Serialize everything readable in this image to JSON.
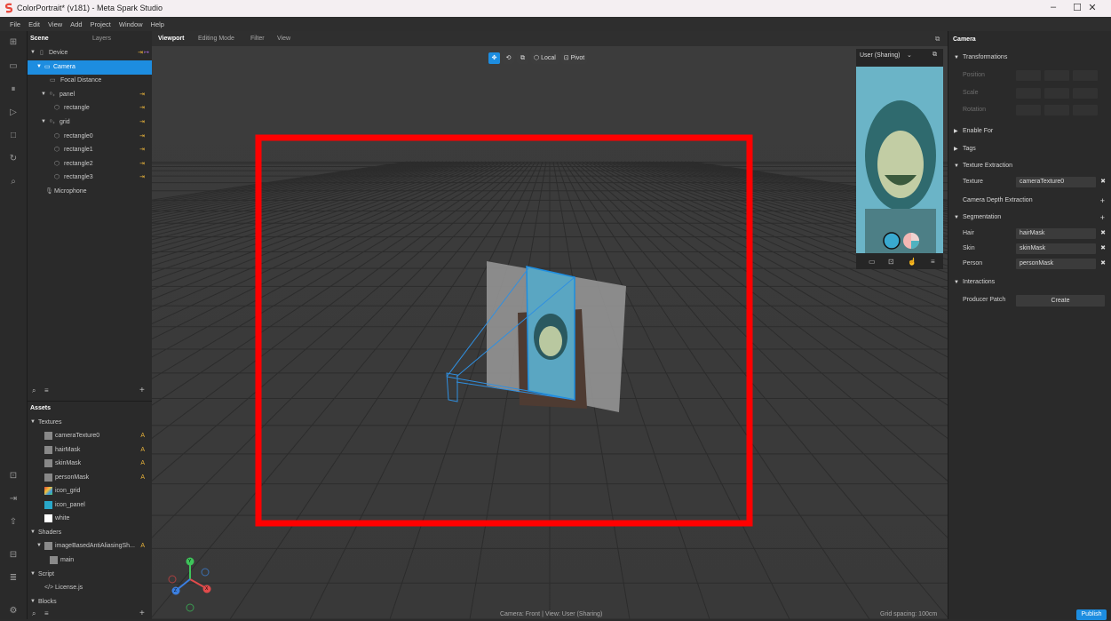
{
  "window": {
    "title": "ColorPortrait* (v181) - Meta Spark Studio",
    "controls": [
      "–",
      "☐",
      "✕"
    ]
  },
  "menu": [
    "File",
    "Edit",
    "View",
    "Add",
    "Project",
    "Window",
    "Help"
  ],
  "scene": {
    "tabs": {
      "scene": "Scene",
      "layers": "Layers"
    },
    "nodes": {
      "device": "Device",
      "camera": "Camera",
      "focal": "Focal Distance",
      "panel": "panel",
      "rectangle": "rectangle",
      "grid": "grid",
      "r0": "rectangle0",
      "r1": "rectangle1",
      "r2": "rectangle2",
      "r3": "rectangle3",
      "microphone": "Microphone"
    }
  },
  "assets": {
    "title": "Assets",
    "textures_header": "Textures",
    "textures": [
      "cameraTexture0",
      "hairMask",
      "skinMask",
      "personMask",
      "icon_grid",
      "icon_panel",
      "white"
    ],
    "texture_flag": "A",
    "shaders_header": "Shaders",
    "shader": "imageBasedAntiAliasingSh...",
    "shader_main": "main",
    "script_header": "Script",
    "script_file": "License.js",
    "blocks_header": "Blocks"
  },
  "viewport": {
    "tabs": [
      "Viewport",
      "Editing Mode",
      "Filter",
      "View"
    ],
    "local": "Local",
    "pivot": "Pivot",
    "status": "Camera: Front | View: User (Sharing)",
    "grid_spacing": "Grid spacing: 100cm",
    "preview_label": "User (Sharing)",
    "axis": {
      "x": "X",
      "y": "Y",
      "z": "Z"
    }
  },
  "properties": {
    "title": "Camera",
    "transformations": "Transformations",
    "position": "Position",
    "scale": "Scale",
    "rotation": "Rotation",
    "enable_for": "Enable For",
    "tags": "Tags",
    "texture_extraction": "Texture Extraction",
    "texture_label": "Texture",
    "texture_value": "cameraTexture0",
    "camera_depth": "Camera Depth Extraction",
    "segmentation": "Segmentation",
    "hair_label": "Hair",
    "hair_value": "hairMask",
    "skin_label": "Skin",
    "skin_value": "skinMask",
    "person_label": "Person",
    "person_value": "personMask",
    "interactions": "Interactions",
    "producer_patch": "Producer Patch",
    "create": "Create",
    "publish": "Publish"
  },
  "colors": {
    "accent": "#1d8de0",
    "highlight_box": "#ff0000",
    "flag": "#e8b23a"
  }
}
